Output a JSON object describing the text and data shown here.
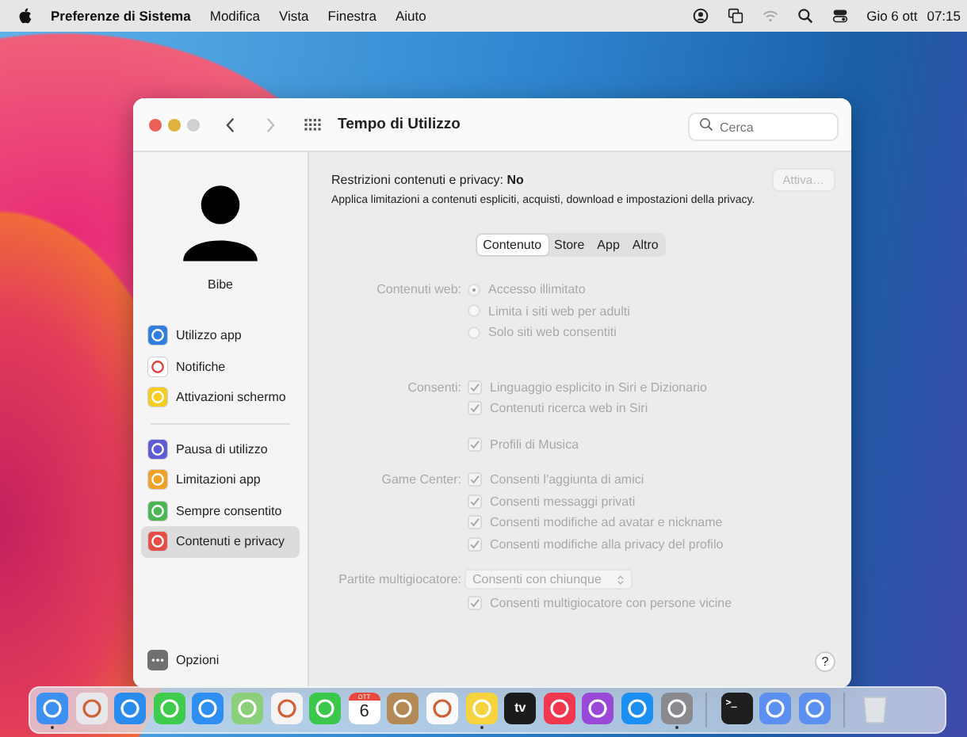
{
  "menu_bar": {
    "app": "Preferenze di Sistema",
    "menus": [
      "Modifica",
      "Vista",
      "Finestra",
      "Aiuto"
    ],
    "date": "Gio 6 ott",
    "time": "07:15"
  },
  "window": {
    "title": "Tempo di Utilizzo",
    "search": {
      "placeholder": "Cerca"
    }
  },
  "sidebar": {
    "user": "Bibe",
    "groups": [
      [
        {
          "label": "Utilizzo app",
          "color": "#2f7de1",
          "selected": false
        },
        {
          "label": "Notifiche",
          "color": "#ffffff",
          "selected": false
        },
        {
          "label": "Attivazioni schermo",
          "color": "#f5cc1f",
          "selected": false
        }
      ],
      [
        {
          "label": "Pausa di utilizzo",
          "color": "#5d5ad6",
          "selected": false
        },
        {
          "label": "Limitazioni app",
          "color": "#f0a126",
          "selected": false
        },
        {
          "label": "Sempre consentito",
          "color": "#4cb655",
          "selected": false
        },
        {
          "label": "Contenuti e privacy",
          "color": "#e64b45",
          "selected": true
        }
      ]
    ],
    "footer": "Opzioni"
  },
  "header": {
    "label": "Restrizioni contenuti e privacy:",
    "value": "No",
    "description": "Applica limitazioni a contenuti espliciti, acquisti, download e impostazioni della privacy.",
    "button": {
      "label": "Attiva…",
      "disabled": true
    }
  },
  "tabs": [
    {
      "label": "Contenuto",
      "selected": true
    },
    {
      "label": "Store",
      "selected": false
    },
    {
      "label": "App",
      "selected": false
    },
    {
      "label": "Altro",
      "selected": false
    }
  ],
  "settings": {
    "disabled": true,
    "sections": [
      {
        "label": "Contenuti web:",
        "controls": [
          {
            "kind": "radio",
            "label": "Accesso illimitato",
            "selected": true
          },
          {
            "kind": "radio",
            "label": "Limita i siti web per adulti",
            "selected": false
          },
          {
            "kind": "radio",
            "label": "Solo siti web consentiti",
            "selected": false
          }
        ]
      },
      {
        "label": "Consenti:",
        "controls": [
          {
            "kind": "checkbox",
            "label": "Linguaggio esplicito in Siri e Dizionario",
            "checked": true
          },
          {
            "kind": "checkbox",
            "label": "Contenuti ricerca web in Siri",
            "checked": true
          }
        ]
      },
      {
        "controls": [
          {
            "kind": "checkbox",
            "label": "Profili di Musica",
            "checked": true
          }
        ]
      },
      {
        "label": "Game Center:",
        "controls": [
          {
            "kind": "checkbox",
            "label": "Consenti l'aggiunta di amici",
            "checked": true
          },
          {
            "kind": "checkbox",
            "label": "Consenti messaggi privati",
            "checked": true
          },
          {
            "kind": "checkbox",
            "label": "Consenti modifiche ad avatar e nickname",
            "checked": true
          },
          {
            "kind": "checkbox",
            "label": "Consenti modifiche alla privacy del profilo",
            "checked": true
          }
        ]
      },
      {
        "label": "Partite multigiocatore:",
        "controls": [
          {
            "kind": "select",
            "value": "Consenti con chiunque"
          },
          {
            "kind": "checkbox",
            "label": "Consenti multigiocatore con persone vicine",
            "checked": true
          }
        ]
      }
    ]
  },
  "help": "?",
  "dock": [
    {
      "kind": "app",
      "color": "#3d8ff0",
      "running": true
    },
    {
      "kind": "app",
      "color": "#e8e8ec",
      "running": false
    },
    {
      "kind": "app",
      "color": "#2a8cef",
      "running": false
    },
    {
      "kind": "app",
      "color": "#3fcb4e",
      "running": false
    },
    {
      "kind": "app",
      "color": "#2e8ef1",
      "running": false
    },
    {
      "kind": "app",
      "color": "#8ccf7a",
      "running": false
    },
    {
      "kind": "app",
      "color": "#f4f4f4",
      "running": false
    },
    {
      "kind": "app",
      "color": "#3ac74c",
      "running": false
    },
    {
      "kind": "calendar",
      "color": "#ffffff",
      "month": "OTT",
      "day": "6",
      "running": false
    },
    {
      "kind": "app",
      "color": "#b38a55",
      "running": false
    },
    {
      "kind": "app",
      "color": "#fafafa",
      "running": false
    },
    {
      "kind": "app",
      "color": "#f7d33e",
      "running": true
    },
    {
      "kind": "tv",
      "color": "#1b1b1b",
      "text": "tv",
      "running": false
    },
    {
      "kind": "app",
      "color": "#f2384f",
      "running": false
    },
    {
      "kind": "app",
      "color": "#9a48d8",
      "running": false
    },
    {
      "kind": "app",
      "color": "#1b8ef2",
      "running": false
    },
    {
      "kind": "app",
      "color": "#8a8a8e",
      "running": true
    },
    {
      "kind": "separator"
    },
    {
      "kind": "terminal",
      "color": "#1e1e1e",
      "text": ">_",
      "running": false
    },
    {
      "kind": "app",
      "color": "#5b8ff0",
      "running": false
    },
    {
      "kind": "app",
      "color": "#5b8ff0",
      "running": false
    },
    {
      "kind": "separator"
    },
    {
      "kind": "trash",
      "color": "#dfe3e6",
      "running": false
    }
  ]
}
